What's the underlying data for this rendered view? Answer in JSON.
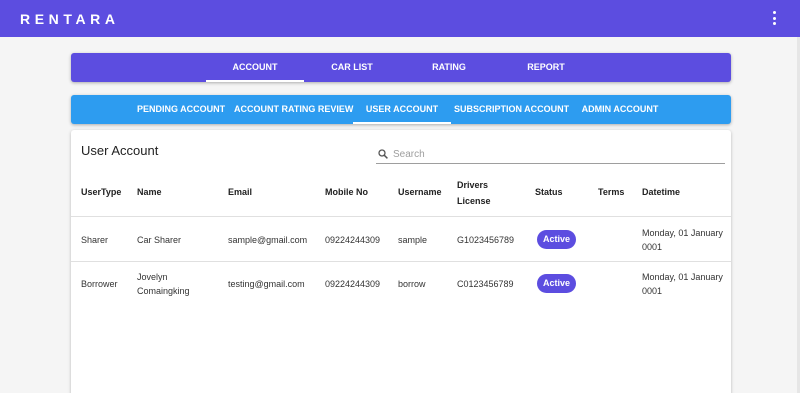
{
  "appbar": {
    "brand": "RENTARA",
    "menu_icon": "more-vert-icon"
  },
  "main_tabs": [
    {
      "label": "ACCOUNT",
      "active": true
    },
    {
      "label": "CAR LIST",
      "active": false
    },
    {
      "label": "RATING",
      "active": false
    },
    {
      "label": "REPORT",
      "active": false
    }
  ],
  "sub_tabs": [
    {
      "label": "PENDING ACCOUNT",
      "active": false
    },
    {
      "label": "ACCOUNT RATING REVIEW",
      "active": false
    },
    {
      "label": "USER ACCOUNT",
      "active": true
    },
    {
      "label": "SUBSCRIPTION ACCOUNT",
      "active": false
    },
    {
      "label": "ADMIN ACCOUNT",
      "active": false
    }
  ],
  "card": {
    "title": "User Account",
    "search": {
      "placeholder": "Search",
      "value": "",
      "icon": "search-icon"
    }
  },
  "table": {
    "headers": [
      "UserType",
      "Name",
      "Email",
      "Mobile No",
      "Username",
      "Drivers License",
      "Status",
      "Terms",
      "Datetime"
    ],
    "rows": [
      {
        "user_type": "Sharer",
        "name": "Car Sharer",
        "email": "sample@gmail.com",
        "mobile": "09224244309",
        "username": "sample",
        "license": "G1023456789",
        "status": "Active",
        "terms": "",
        "datetime": "Monday, 01 January 0001"
      },
      {
        "user_type": "Borrower",
        "name": "Jovelyn Comaingking",
        "email": "testing@gmail.com",
        "mobile": "09224244309",
        "username": "borrow",
        "license": "C0123456789",
        "status": "Active",
        "terms": "",
        "datetime": "Monday, 01 January 0001"
      }
    ]
  },
  "colors": {
    "primary": "#5c4de0",
    "secondary": "#2d9cf0",
    "chip": "#5c4de0"
  }
}
